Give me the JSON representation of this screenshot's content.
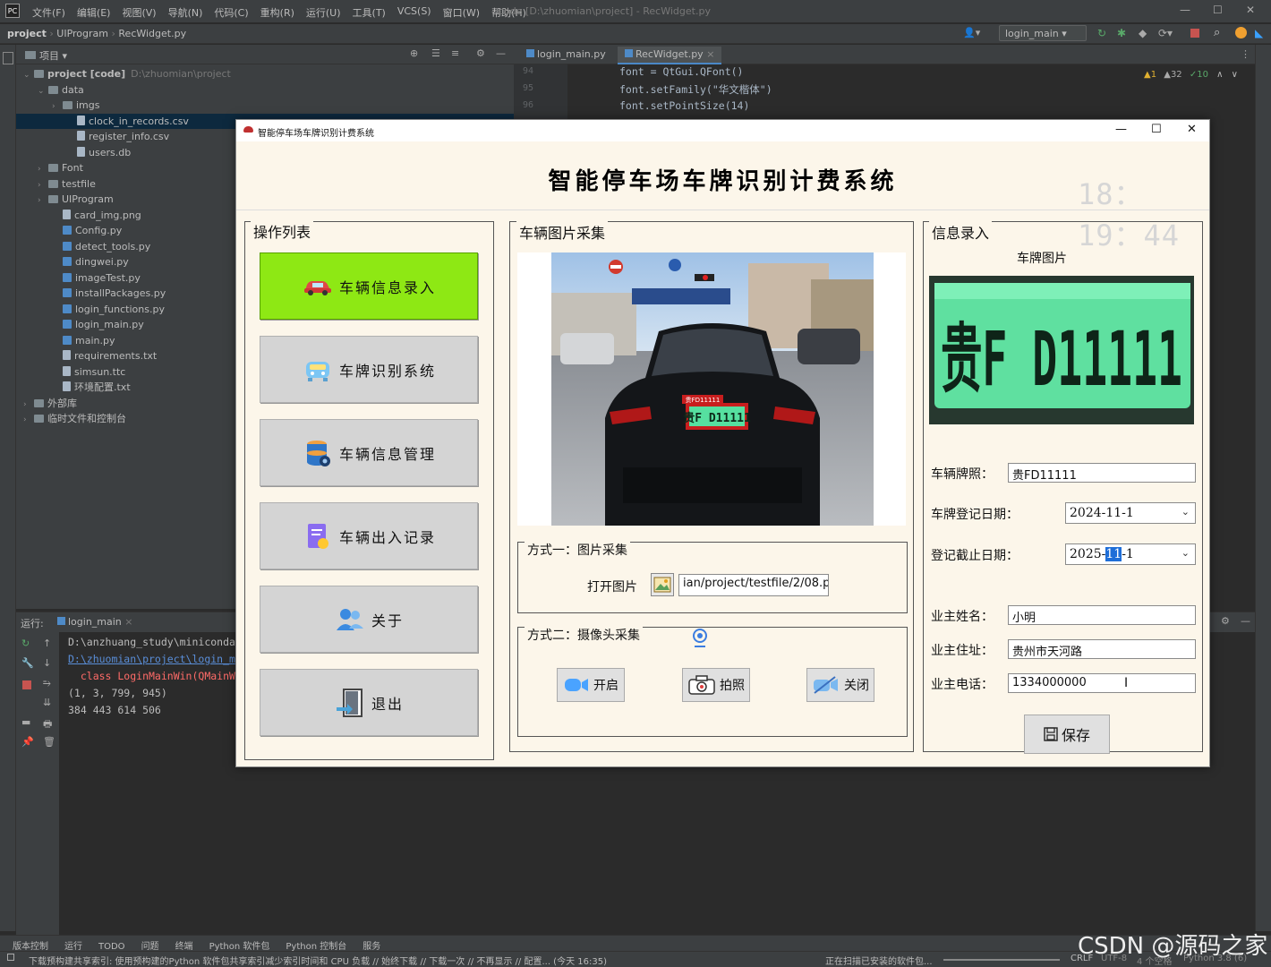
{
  "ide": {
    "menus": [
      "文件(F)",
      "编辑(E)",
      "视图(V)",
      "导航(N)",
      "代码(C)",
      "重构(R)",
      "运行(U)",
      "工具(T)",
      "VCS(S)",
      "窗口(W)",
      "帮助(H)"
    ],
    "window_title": "code [D:\\zhuomian\\project] - RecWidget.py",
    "breadcrumb": [
      "project",
      "UIProgram",
      "RecWidget.py"
    ],
    "run_config": "login_main",
    "project_label": "项目",
    "tree": [
      {
        "label": "project [code]",
        "path": "D:\\zhuomian\\project",
        "kind": "folder",
        "depth": 0,
        "arrow": "v"
      },
      {
        "label": "data",
        "kind": "folder",
        "depth": 1,
        "arrow": "v"
      },
      {
        "label": "imgs",
        "kind": "folder",
        "depth": 2,
        "arrow": ">"
      },
      {
        "label": "clock_in_records.csv",
        "kind": "file",
        "depth": 3,
        "selected": true
      },
      {
        "label": "register_info.csv",
        "kind": "file",
        "depth": 3
      },
      {
        "label": "users.db",
        "kind": "file",
        "depth": 3
      },
      {
        "label": "Font",
        "kind": "folder",
        "depth": 1,
        "arrow": ">"
      },
      {
        "label": "testfile",
        "kind": "folder",
        "depth": 1,
        "arrow": ">"
      },
      {
        "label": "UIProgram",
        "kind": "folder",
        "depth": 1,
        "arrow": ">"
      },
      {
        "label": "card_img.png",
        "kind": "file",
        "depth": 2
      },
      {
        "label": "Config.py",
        "kind": "py",
        "depth": 2
      },
      {
        "label": "detect_tools.py",
        "kind": "py",
        "depth": 2
      },
      {
        "label": "dingwei.py",
        "kind": "py",
        "depth": 2
      },
      {
        "label": "imageTest.py",
        "kind": "py",
        "depth": 2
      },
      {
        "label": "installPackages.py",
        "kind": "py",
        "depth": 2
      },
      {
        "label": "login_functions.py",
        "kind": "py",
        "depth": 2
      },
      {
        "label": "login_main.py",
        "kind": "py",
        "depth": 2
      },
      {
        "label": "main.py",
        "kind": "py",
        "depth": 2
      },
      {
        "label": "requirements.txt",
        "kind": "file",
        "depth": 2
      },
      {
        "label": "simsun.ttc",
        "kind": "file",
        "depth": 2
      },
      {
        "label": "环境配置.txt",
        "kind": "file",
        "depth": 2
      },
      {
        "label": "外部库",
        "kind": "folder",
        "depth": 0,
        "arrow": ">"
      },
      {
        "label": "临时文件和控制台",
        "kind": "folder",
        "depth": 0,
        "arrow": ">"
      }
    ],
    "tabs": [
      "login_main.py",
      "RecWidget.py"
    ],
    "code_lines": [
      {
        "num": "94",
        "text": "font = QtGui.QFont()"
      },
      {
        "num": "95",
        "text": "font.setFamily(\"华文楷体\")"
      },
      {
        "num": "96",
        "text": "font.setPointSize(14)"
      }
    ],
    "inspections": {
      "warn": "▲1",
      "weak": "▲32",
      "ok": "✓10"
    },
    "run_label": "运行:",
    "run_tab": "login_main",
    "run_output": [
      "D:\\anzhuang_study\\miniconda",
      "D:\\zhuomian\\project\\login_m",
      "  class LoginMainWin(QMainW",
      "(1, 3, 799, 945)",
      "384 443 614 506"
    ],
    "bottom_tabs": [
      "版本控制",
      "运行",
      "TODO",
      "问题",
      "终端",
      "Python 软件包",
      "Python 控制台",
      "服务"
    ],
    "status_left": "下载预构建共享索引: 使用预构建的Python 软件包共享索引减少索引时间和 CPU 负载 // 始终下载 // 下载一次 // 不再显示 // 配置... (今天 16:35)",
    "status_mid": "正在扫描已安装的软件包...",
    "status_right": [
      "CRLF",
      "UTF-8",
      "4 个空格",
      "Python 3.8 (6)"
    ],
    "watermark": "CSDN @源码之家"
  },
  "app": {
    "window_title": "智能停车场车牌识别计费系统",
    "heading": "智能停车场车牌识别计费系统",
    "clock": "18：19：44",
    "ops_group": "操作列表",
    "nav": [
      {
        "label": "车辆信息录入",
        "icon": "car-icon",
        "active": true
      },
      {
        "label": "车牌识别系统",
        "icon": "robot-car-icon",
        "active": false
      },
      {
        "label": "车辆信息管理",
        "icon": "database-icon",
        "active": false
      },
      {
        "label": "车辆出入记录",
        "icon": "record-icon",
        "active": false
      },
      {
        "label": "关于",
        "icon": "users-icon",
        "active": false
      },
      {
        "label": "退出",
        "icon": "exit-icon",
        "active": false
      }
    ],
    "capture_group": "车辆图片采集",
    "detected_plate_tag": "贵FD11111",
    "photo_plate_text": "贵F D11111",
    "method1_group": "方式一：图片采集",
    "open_image_label": "打开图片",
    "image_path": "ian/project/testfile/2/08.png",
    "method2_group": "方式二：摄像头采集",
    "cam_buttons": [
      "开启",
      "拍照",
      "关闭"
    ],
    "info_group": "信息录入",
    "plate_image_label": "车牌图片",
    "plate_crop_text": "贵F D11111",
    "fields": {
      "plate_label": "车辆牌照：",
      "plate_value": "贵FD11111",
      "reg_label": "车牌登记日期：",
      "reg_value": "2024-11-1",
      "exp_label": "登记截止日期：",
      "exp_prefix": "2025-",
      "exp_sel": "11",
      "exp_suffix": "-1",
      "owner_label": "业主姓名：",
      "owner_value": "小明",
      "addr_label": "业主住址：",
      "addr_value": "贵州市天河路",
      "phone_label": "业主电话：",
      "phone_value": "1334000000"
    },
    "save_label": "保存",
    "colors": {
      "active_nav": "#8ee814",
      "plate_green": "#5fe0a0",
      "bg": "#fcf6ea"
    }
  }
}
